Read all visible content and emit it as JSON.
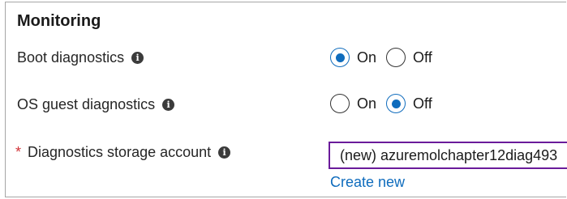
{
  "section": {
    "title": "Monitoring"
  },
  "boot_diagnostics": {
    "label": "Boot diagnostics",
    "options": [
      {
        "label": "On",
        "selected": true
      },
      {
        "label": "Off",
        "selected": false
      }
    ]
  },
  "os_guest_diagnostics": {
    "label": "OS guest diagnostics",
    "options": [
      {
        "label": "On",
        "selected": false
      },
      {
        "label": "Off",
        "selected": true
      }
    ]
  },
  "storage_account": {
    "required_marker": "*",
    "label": "Diagnostics storage account",
    "value": "(new) azuremolchapter12diag493",
    "create_link": "Create new"
  },
  "icons": {
    "info": "i"
  },
  "colors": {
    "accent": "#0f6cbd",
    "required": "#d13438",
    "focus_border": "#6a1b9a"
  }
}
